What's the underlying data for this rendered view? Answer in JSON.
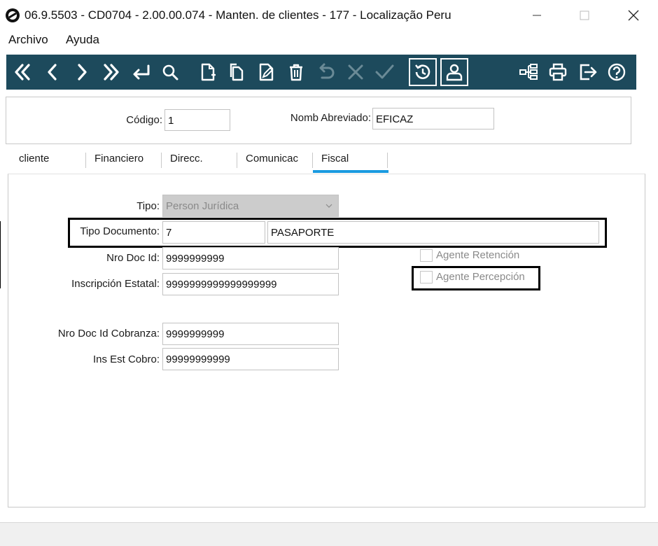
{
  "window": {
    "title": "06.9.5503 - CD0704 - 2.00.00.074 - Manten. de clientes - 177 - Localização Peru"
  },
  "menu": {
    "items": [
      "Archivo",
      "Ayuda"
    ]
  },
  "toolbar": {
    "background": "#1d4a5c",
    "icons": [
      "first-icon",
      "previous-icon",
      "next-icon",
      "last-icon",
      "return-icon",
      "search-icon",
      "new-icon",
      "copy-icon",
      "edit-icon",
      "delete-icon",
      "undo-icon",
      "cancel-icon",
      "confirm-icon",
      "history-icon",
      "user-icon",
      "tree-icon",
      "print-icon",
      "exit-icon",
      "help-icon"
    ]
  },
  "header": {
    "codigo_label": "Código:",
    "codigo_value": "1",
    "nomb_label": "Nomb Abreviado:",
    "nomb_value": "EFICAZ"
  },
  "tabs": [
    "cliente",
    "Financiero",
    "Direcc.",
    "Comunicac",
    "Fiscal"
  ],
  "active_tab": "Fiscal",
  "accent_color": "#1a9ae0",
  "fiscal": {
    "tipo_label": "Tipo:",
    "tipo_value": "Person Jurídica",
    "tipo_doc_label": "Tipo Documento:",
    "tipo_doc_code": "7",
    "tipo_doc_desc": "PASAPORTE",
    "nro_doc_label": "Nro Doc Id:",
    "nro_doc_value": "9999999999",
    "insc_label": "Inscripción Estatal:",
    "insc_value": "9999999999999999999",
    "nro_cobr_label": "Nro Doc Id Cobranza:",
    "nro_cobr_value": "9999999999",
    "ins_cobro_label": "Ins Est Cobro:",
    "ins_cobro_value": "99999999999",
    "agente_retencion_label": "Agente Retención",
    "agente_retencion_checked": false,
    "agente_percepcion_label": "Agente Percepción",
    "agente_percepcion_checked": false
  }
}
